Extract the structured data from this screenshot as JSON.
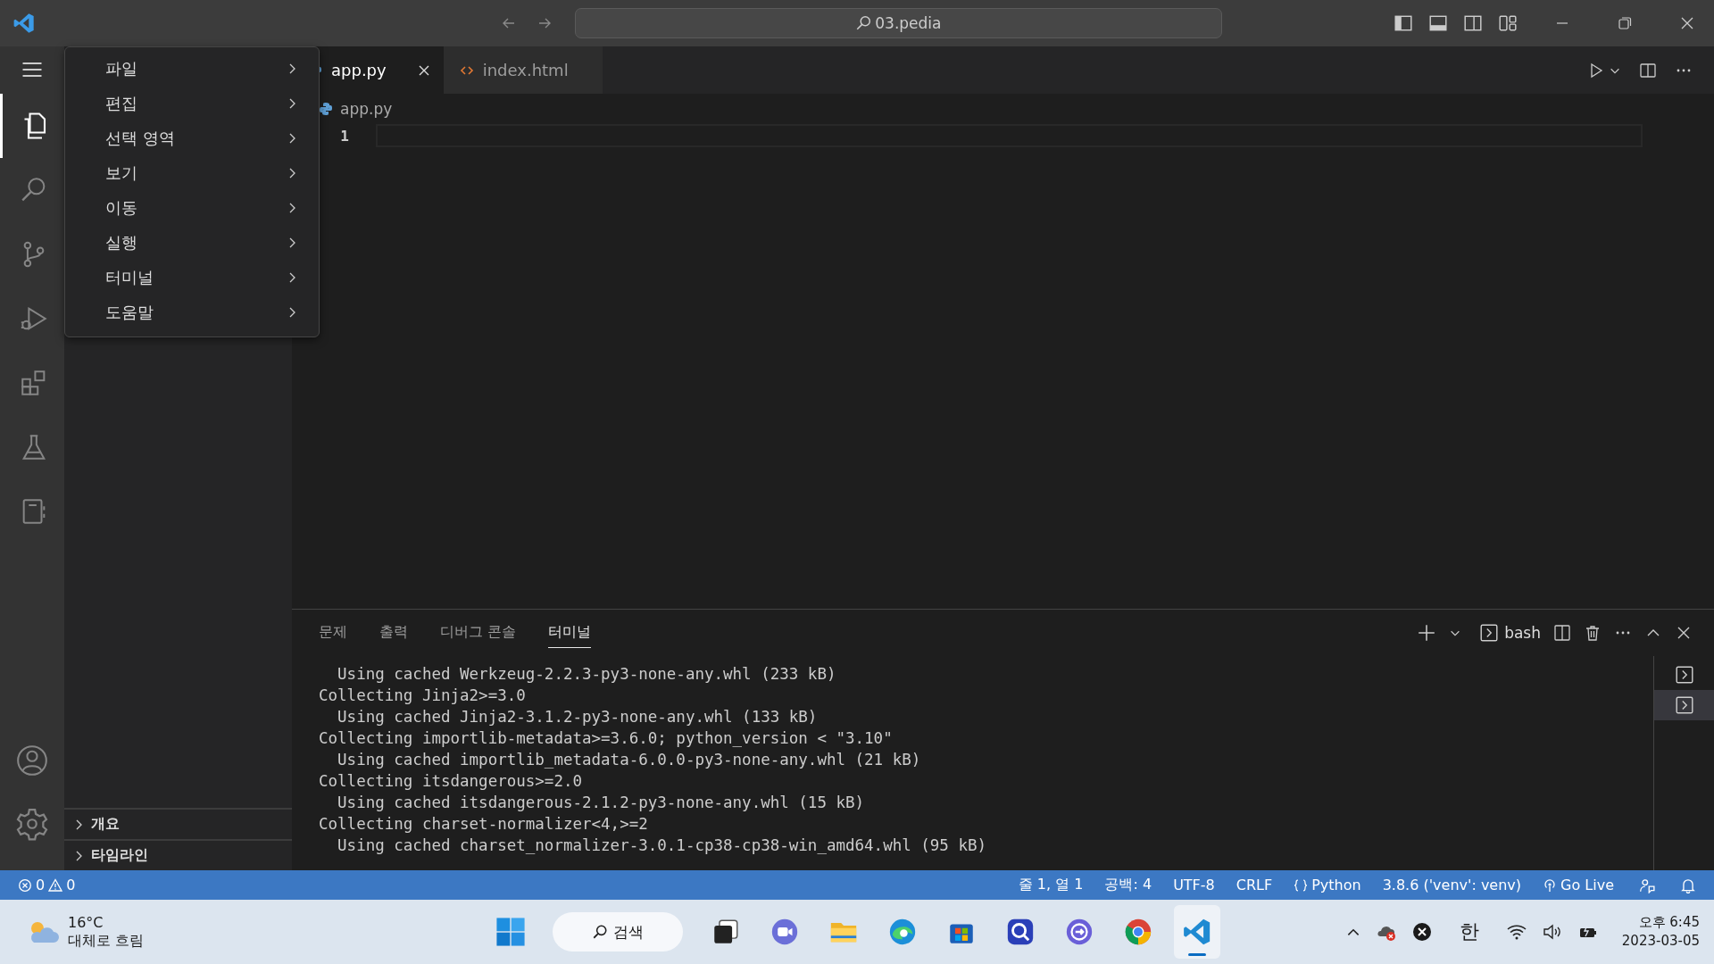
{
  "title_bar": {
    "search": "03.pedia"
  },
  "menu": [
    {
      "label": "파일"
    },
    {
      "label": "편집"
    },
    {
      "label": "선택 영역"
    },
    {
      "label": "보기"
    },
    {
      "label": "이동"
    },
    {
      "label": "실행"
    },
    {
      "label": "터미널"
    },
    {
      "label": "도움말"
    }
  ],
  "activity_bar": [
    {
      "kind": "explorer",
      "selected": true
    },
    {
      "kind": "search",
      "selected": false
    },
    {
      "kind": "source-control",
      "selected": false
    },
    {
      "kind": "run-debug",
      "selected": false
    },
    {
      "kind": "extensions",
      "selected": false
    },
    {
      "kind": "testing",
      "selected": false
    },
    {
      "kind": "notebook",
      "selected": false
    }
  ],
  "sidebar_sections": [
    {
      "label": "개요",
      "expanded": false
    },
    {
      "label": "타임라인",
      "expanded": false
    }
  ],
  "editor_tabs": [
    {
      "label": "app.py",
      "kind": "python",
      "selected": true
    },
    {
      "label": "index.html",
      "kind": "html",
      "selected": false
    }
  ],
  "breadcrumb": "app.py",
  "line_numbers": [
    "1"
  ],
  "panel_tabs": [
    {
      "label": "문제",
      "selected": false
    },
    {
      "label": "출력",
      "selected": false
    },
    {
      "label": "디버그 콘솔",
      "selected": false
    },
    {
      "label": "터미널",
      "selected": true
    }
  ],
  "terminal": {
    "shell": "bash",
    "lines": [
      "  Using cached Werkzeug-2.2.3-py3-none-any.whl (233 kB)",
      "Collecting Jinja2>=3.0",
      "  Using cached Jinja2-3.1.2-py3-none-any.whl (133 kB)",
      "Collecting importlib-metadata>=3.6.0; python_version < \"3.10\"",
      "  Using cached importlib_metadata-6.0.0-py3-none-any.whl (21 kB)",
      "Collecting itsdangerous>=2.0",
      "  Using cached itsdangerous-2.1.2-py3-none-any.whl (15 kB)",
      "Collecting charset-normalizer<4,>=2",
      "  Using cached charset_normalizer-3.0.1-cp38-cp38-win_amd64.whl (95 kB)"
    ],
    "instances": [
      {
        "selected": false
      },
      {
        "selected": true
      }
    ]
  },
  "status_bar": {
    "errors": "0",
    "warnings": "0",
    "items": [
      {
        "kind": "text",
        "label": "줄 1, 열 1"
      },
      {
        "kind": "text",
        "label": "공백: 4"
      },
      {
        "kind": "text",
        "label": "UTF-8"
      },
      {
        "kind": "text",
        "label": "CRLF"
      },
      {
        "kind": "language",
        "label": "Python"
      },
      {
        "kind": "text",
        "label": "3.8.6 ('venv': venv)"
      },
      {
        "kind": "golive",
        "label": "Go Live"
      }
    ]
  },
  "taskbar": {
    "temperature": "16°C",
    "weather": "대체로 흐림",
    "search": "검색",
    "apps": [
      {
        "kind": "task-view",
        "selected": false
      },
      {
        "kind": "chat",
        "selected": false
      },
      {
        "kind": "folder",
        "selected": false
      },
      {
        "kind": "edge",
        "selected": false
      },
      {
        "kind": "store",
        "selected": false
      },
      {
        "kind": "lens",
        "selected": false
      },
      {
        "kind": "arrow-circle",
        "selected": false
      },
      {
        "kind": "chrome",
        "selected": false
      },
      {
        "kind": "vscode",
        "selected": true
      }
    ],
    "ime": "한",
    "time": "오후 6:45",
    "date": "2023-03-05"
  }
}
